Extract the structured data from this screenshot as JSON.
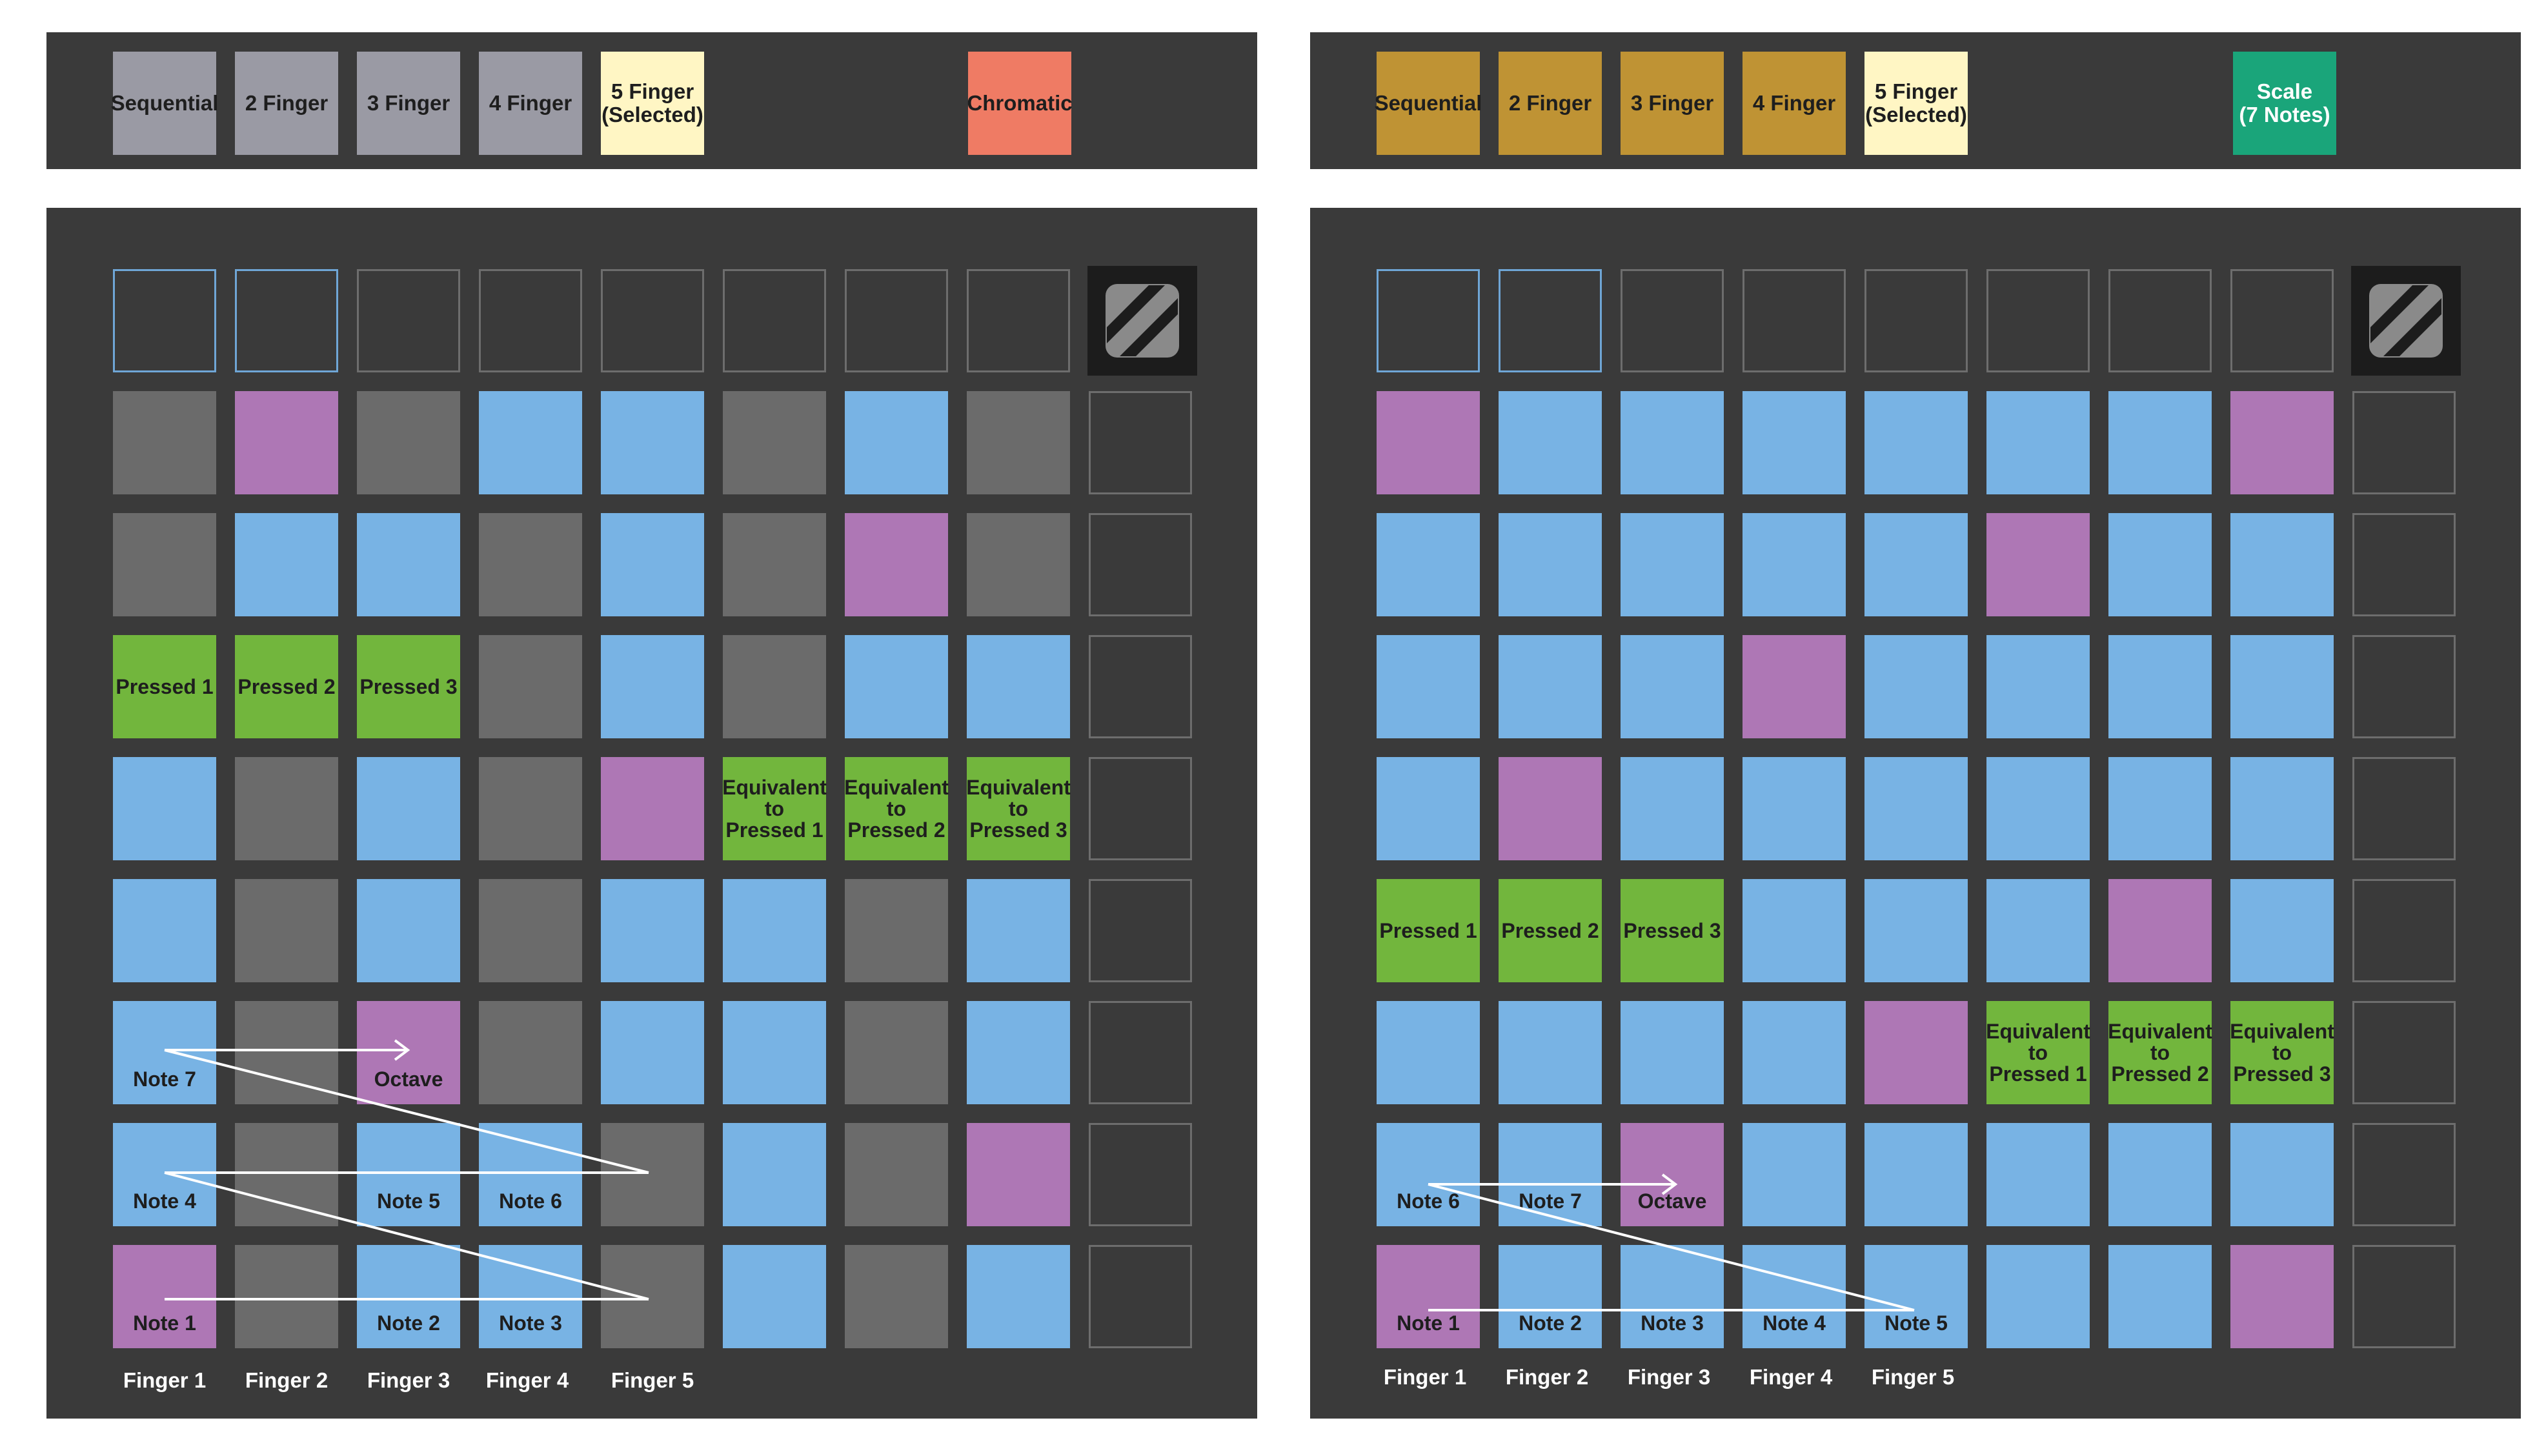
{
  "colors": {
    "panel": "#3a3a3a",
    "blue": "#78b3e4",
    "gray": "#6b6b6b",
    "purple": "#ae77b5",
    "green": "#72b63d",
    "selected": "#fff6c4",
    "chromatic_button": "#ef7b64",
    "scale_button": "#1aa57a",
    "left_mode_button": "#9a9aa4",
    "right_mode_button": "#bf9334"
  },
  "left": {
    "mode_buttons": [
      "Sequential",
      "2 Finger",
      "3 Finger",
      "4 Finger",
      "5 Finger\n(Selected)"
    ],
    "layout_button": "Chromatic",
    "fingers": [
      "Finger 1",
      "Finger 2",
      "Finger 3",
      "Finger 4",
      "Finger 5"
    ],
    "grid": [
      [
        "gray",
        "purple",
        "gray",
        "blue",
        "blue",
        "gray",
        "blue",
        "gray"
      ],
      [
        "gray",
        "blue",
        "blue",
        "gray",
        "blue",
        "gray",
        "purple",
        "gray"
      ],
      [
        "green",
        "green",
        "green",
        "gray",
        "blue",
        "gray",
        "blue",
        "blue"
      ],
      [
        "blue",
        "gray",
        "blue",
        "gray",
        "purple",
        "green",
        "green",
        "green"
      ],
      [
        "blue",
        "gray",
        "blue",
        "gray",
        "blue",
        "blue",
        "gray",
        "blue"
      ],
      [
        "blue",
        "gray",
        "purple",
        "gray",
        "blue",
        "blue",
        "gray",
        "blue"
      ],
      [
        "blue",
        "gray",
        "blue",
        "blue",
        "gray",
        "blue",
        "gray",
        "purple"
      ],
      [
        "purple",
        "gray",
        "blue",
        "blue",
        "gray",
        "blue",
        "gray",
        "blue"
      ]
    ],
    "labels": [
      {
        "r": 2,
        "c": 0,
        "text": "Pressed 1"
      },
      {
        "r": 2,
        "c": 1,
        "text": "Pressed 2"
      },
      {
        "r": 2,
        "c": 2,
        "text": "Pressed 3"
      },
      {
        "r": 3,
        "c": 5,
        "text": "Equivalent\nto\nPressed 1"
      },
      {
        "r": 3,
        "c": 6,
        "text": "Equivalent\nto\nPressed 2"
      },
      {
        "r": 3,
        "c": 7,
        "text": "Equivalent\nto\nPressed 3"
      },
      {
        "r": 5,
        "c": 0,
        "text": "Note 7",
        "bottom": true
      },
      {
        "r": 5,
        "c": 2,
        "text": "Octave",
        "bottom": true
      },
      {
        "r": 6,
        "c": 0,
        "text": "Note 4",
        "bottom": true
      },
      {
        "r": 6,
        "c": 2,
        "text": "Note 5",
        "bottom": true
      },
      {
        "r": 6,
        "c": 3,
        "text": "Note 6",
        "bottom": true
      },
      {
        "r": 7,
        "c": 0,
        "text": "Note 1",
        "bottom": true
      },
      {
        "r": 7,
        "c": 2,
        "text": "Note 2",
        "bottom": true
      },
      {
        "r": 7,
        "c": 3,
        "text": "Note 3",
        "bottom": true
      }
    ]
  },
  "right": {
    "mode_buttons": [
      "Sequential",
      "2 Finger",
      "3 Finger",
      "4 Finger",
      "5 Finger\n(Selected)"
    ],
    "layout_button": "Scale\n(7 Notes)",
    "fingers": [
      "Finger 1",
      "Finger 2",
      "Finger 3",
      "Finger 4",
      "Finger 5"
    ],
    "grid": [
      [
        "purple",
        "blue",
        "blue",
        "blue",
        "blue",
        "blue",
        "blue",
        "purple"
      ],
      [
        "blue",
        "blue",
        "blue",
        "blue",
        "blue",
        "purple",
        "blue",
        "blue"
      ],
      [
        "blue",
        "blue",
        "blue",
        "purple",
        "blue",
        "blue",
        "blue",
        "blue"
      ],
      [
        "blue",
        "purple",
        "blue",
        "blue",
        "blue",
        "blue",
        "blue",
        "blue"
      ],
      [
        "green",
        "green",
        "green",
        "blue",
        "blue",
        "blue",
        "purple",
        "blue"
      ],
      [
        "blue",
        "blue",
        "blue",
        "blue",
        "purple",
        "green",
        "green",
        "green"
      ],
      [
        "blue",
        "blue",
        "purple",
        "blue",
        "blue",
        "blue",
        "blue",
        "blue"
      ],
      [
        "purple",
        "blue",
        "blue",
        "blue",
        "blue",
        "blue",
        "blue",
        "purple"
      ]
    ],
    "labels": [
      {
        "r": 4,
        "c": 0,
        "text": "Pressed 1"
      },
      {
        "r": 4,
        "c": 1,
        "text": "Pressed 2"
      },
      {
        "r": 4,
        "c": 2,
        "text": "Pressed 3"
      },
      {
        "r": 5,
        "c": 5,
        "text": "Equivalent\nto\nPressed 1"
      },
      {
        "r": 5,
        "c": 6,
        "text": "Equivalent\nto\nPressed 2"
      },
      {
        "r": 5,
        "c": 7,
        "text": "Equivalent\nto\nPressed 3"
      },
      {
        "r": 6,
        "c": 0,
        "text": "Note 6",
        "bottom": true
      },
      {
        "r": 6,
        "c": 1,
        "text": "Note 7",
        "bottom": true
      },
      {
        "r": 6,
        "c": 2,
        "text": "Octave",
        "bottom": true
      },
      {
        "r": 7,
        "c": 0,
        "text": "Note 1",
        "bottom": true
      },
      {
        "r": 7,
        "c": 1,
        "text": "Note 2",
        "bottom": true
      },
      {
        "r": 7,
        "c": 2,
        "text": "Note 3",
        "bottom": true
      },
      {
        "r": 7,
        "c": 3,
        "text": "Note 4",
        "bottom": true
      },
      {
        "r": 7,
        "c": 4,
        "text": "Note 5",
        "bottom": true
      }
    ]
  }
}
